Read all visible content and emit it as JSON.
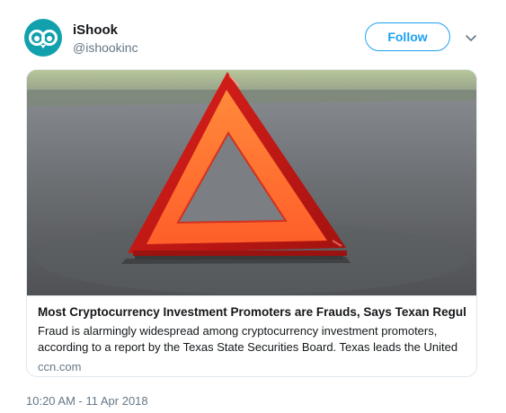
{
  "colors": {
    "brand_teal": "#12a0ad",
    "follow_blue": "#1da1f2",
    "muted": "#657786"
  },
  "author": {
    "avatar_icon": "owl-eyes-logo-icon",
    "name": "iShook",
    "handle": "@ishookinc"
  },
  "actions": {
    "follow_label": "Follow",
    "more_icon": "chevron-down-icon"
  },
  "card": {
    "image_subject": "warning-triangle-photo",
    "title": "Most Cryptocurrency Investment Promoters are Frauds, Says Texan Regulator",
    "description": "Fraud is alarmingly widespread among cryptocurrency investment promoters, according to a report by the Texas State Securities Board. Texas leads the United ...",
    "domain": "ccn.com"
  },
  "timestamp": "10:20 AM - 11 Apr 2018"
}
